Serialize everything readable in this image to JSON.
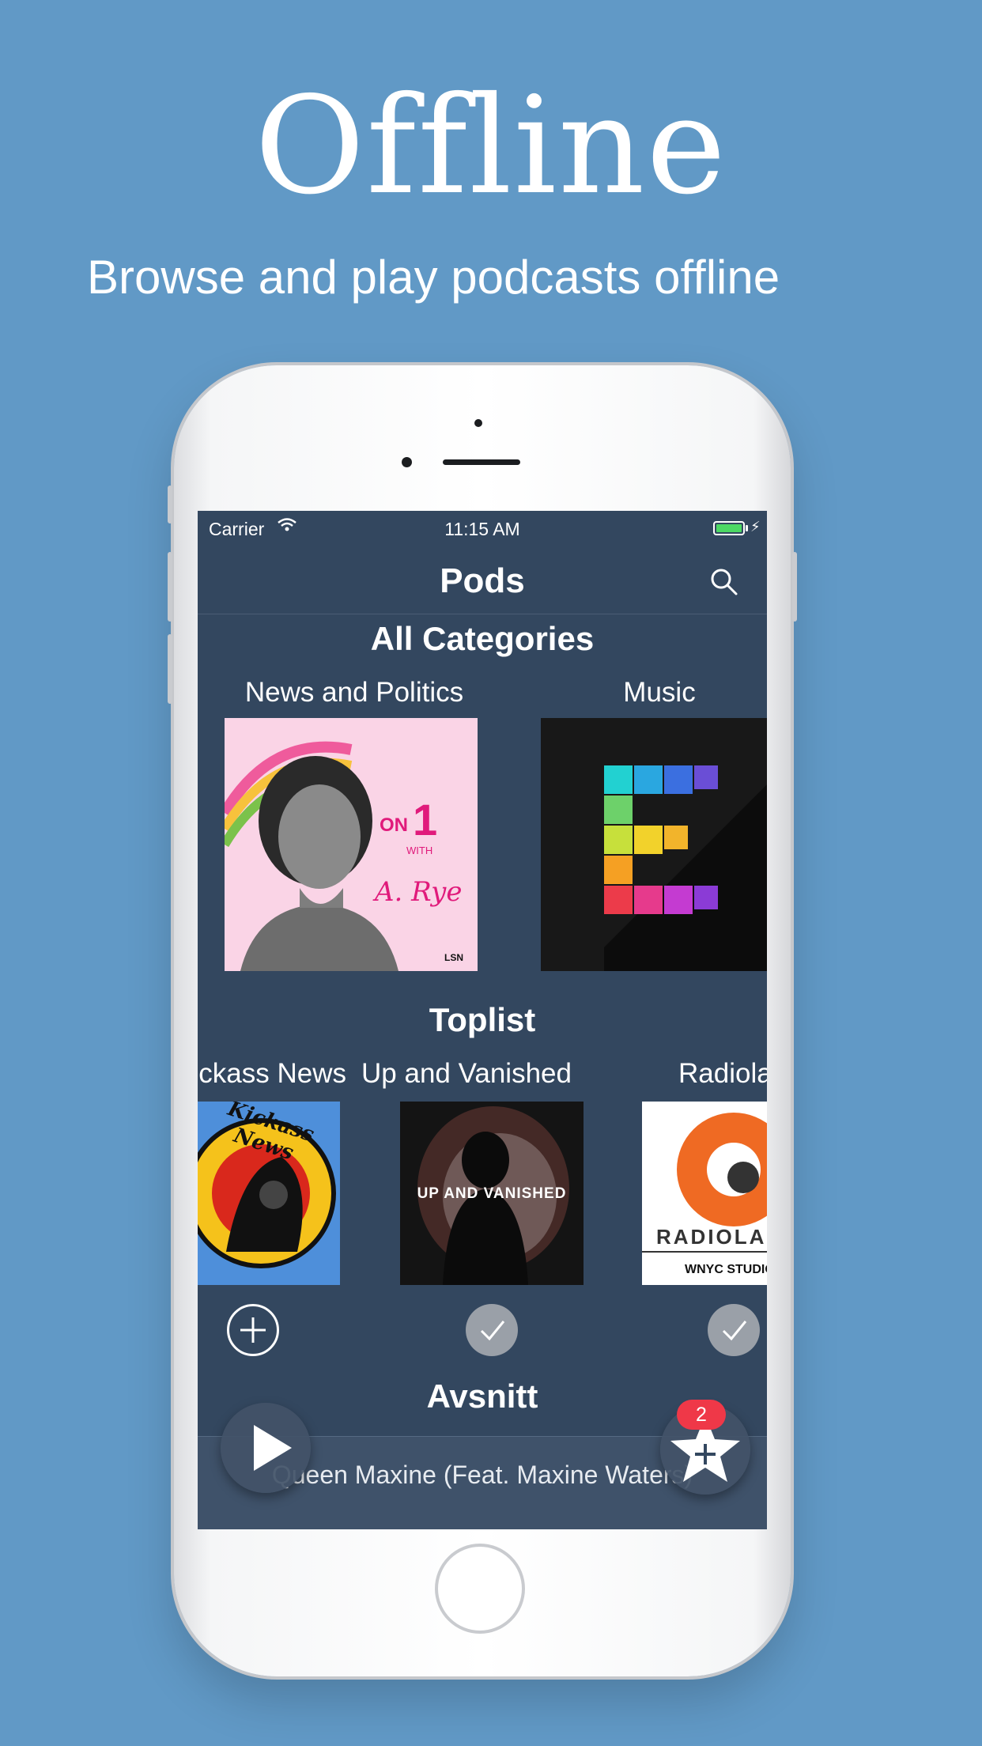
{
  "hero": {
    "title": "Offline",
    "subtitle": "Browse and play podcasts offline"
  },
  "status_bar": {
    "carrier": "Carrier",
    "time": "11:15 AM",
    "battery_color": "#4cd964"
  },
  "nav": {
    "title": "Pods",
    "search_icon": "search-icon"
  },
  "categories": {
    "heading": "All Categories",
    "items": [
      {
        "label": "News and Politics",
        "art_text_on": "ON",
        "art_text_num": "1",
        "art_text_with": "WITH",
        "art_text_name": "A. Rye",
        "art_text_network": "LSN"
      },
      {
        "label": "Music"
      }
    ]
  },
  "toplist": {
    "heading": "Toplist",
    "items": [
      {
        "label": "Kickass News",
        "art_text": "Kickass News",
        "state": "add"
      },
      {
        "label": "Up and Vanished",
        "art_text": "UP AND VANISHED",
        "state": "subscribed"
      },
      {
        "label": "Radiolab",
        "art_text": "RADIOLAB",
        "art_sub": "WNYC STUDIOS",
        "state": "subscribed"
      }
    ]
  },
  "episodes": {
    "heading": "Avsnitt",
    "now_playing": "Queen Maxine (Feat. Maxine Waters)"
  },
  "favorites": {
    "badge_count": "2"
  },
  "colors": {
    "background": "#6199c6",
    "app_background": "#33475f",
    "badge": "#ef3848"
  }
}
